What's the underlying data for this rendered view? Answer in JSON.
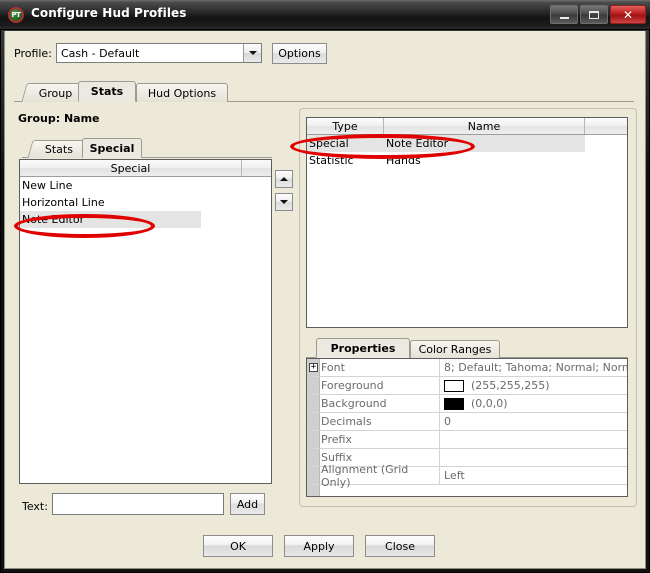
{
  "window": {
    "title": "Configure Hud Profiles",
    "icon": "pokertracker-icon",
    "icon_text": "PT",
    "controls": {
      "minimize": "minimize-icon",
      "maximize": "maximize-icon",
      "close": "close-icon",
      "close_glyph": "✕"
    }
  },
  "profile": {
    "label": "Profile:",
    "value": "Cash - Default",
    "options_button": "Options"
  },
  "main_tabs": [
    {
      "label": "Group",
      "selected": false
    },
    {
      "label": "Stats",
      "selected": true
    },
    {
      "label": "Hud Options",
      "selected": false
    }
  ],
  "group": {
    "label": "Group:",
    "name": "Name",
    "full": "Group:  Name"
  },
  "left_panel": {
    "sub_tabs": [
      {
        "label": "Stats",
        "selected": false
      },
      {
        "label": "Special",
        "selected": true
      }
    ],
    "list": {
      "columns": [
        "Special",
        ""
      ],
      "rows": [
        {
          "value": "New Line",
          "selected": false
        },
        {
          "value": "Horizontal Line",
          "selected": false
        },
        {
          "value": "Note Editor",
          "selected": true
        }
      ]
    },
    "movers": {
      "up": "move-up-icon",
      "down": "move-down-icon"
    },
    "text": {
      "label": "Text:",
      "value": "",
      "placeholder": ""
    },
    "add_button": "Add"
  },
  "right_panel": {
    "table": {
      "columns": [
        "Type",
        "Name",
        ""
      ],
      "rows": [
        {
          "type": "Special",
          "name": "Note Editor",
          "selected": true
        },
        {
          "type": "Statistic",
          "name": "Hands",
          "selected": false
        }
      ]
    },
    "sub_tabs": [
      {
        "label": "Properties",
        "selected": true
      },
      {
        "label": "Color Ranges",
        "selected": false
      }
    ],
    "properties": [
      {
        "name": "Font",
        "value": "8; Default; Tahoma; Normal; Norm",
        "expandable": true,
        "expander_glyph": "+"
      },
      {
        "name": "Foreground",
        "value": "(255,255,255)",
        "swatch": "#ffffff"
      },
      {
        "name": "Background",
        "value": "(0,0,0)",
        "swatch": "#000000"
      },
      {
        "name": "Decimals",
        "value": "0"
      },
      {
        "name": "Prefix",
        "value": ""
      },
      {
        "name": "Suffix",
        "value": ""
      },
      {
        "name": "Alignment (Grid Only)",
        "value": "Left"
      }
    ]
  },
  "dialog_buttons": [
    {
      "label": "OK"
    },
    {
      "label": "Apply"
    },
    {
      "label": "Close"
    }
  ],
  "annotations": {
    "highlight_color": "#e00000",
    "note": "two red ellipses highlighting the selected 'Note Editor' entries"
  }
}
